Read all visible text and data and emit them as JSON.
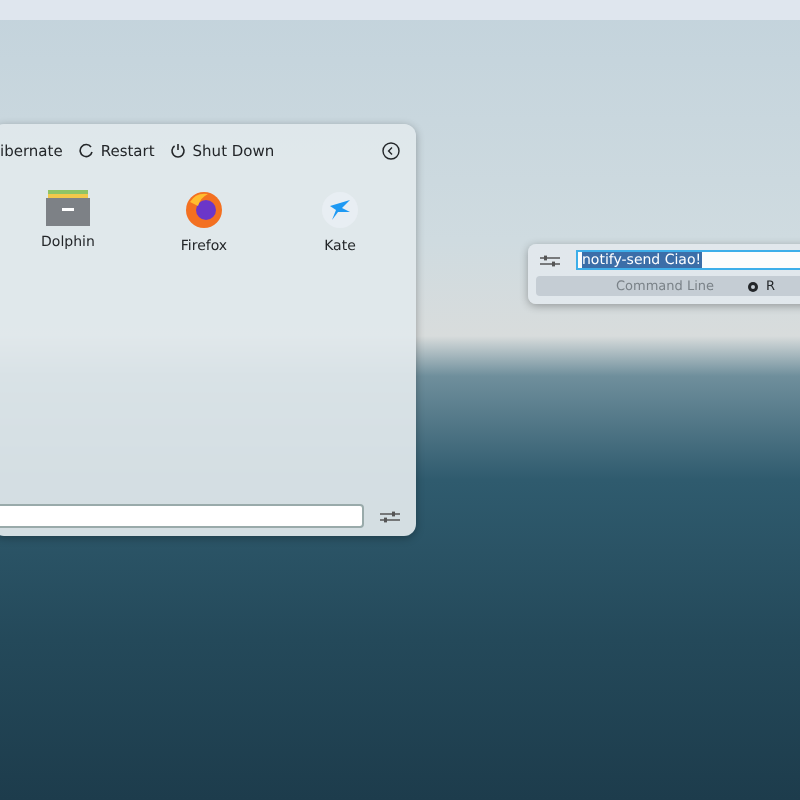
{
  "launcher": {
    "power_actions": [
      {
        "label": "ibernate"
      },
      {
        "label": "Restart"
      },
      {
        "label": "Shut Down"
      }
    ],
    "apps": [
      {
        "name": "Dolphin",
        "kind": "folder"
      },
      {
        "name": "Firefox",
        "kind": "browser"
      },
      {
        "name": "Kate",
        "kind": "editor"
      }
    ]
  },
  "krunner": {
    "query": "notify-send Ciao!",
    "tabs": [
      {
        "label": "Command Line",
        "selected": false
      },
      {
        "label": "R",
        "selected": false
      }
    ]
  }
}
